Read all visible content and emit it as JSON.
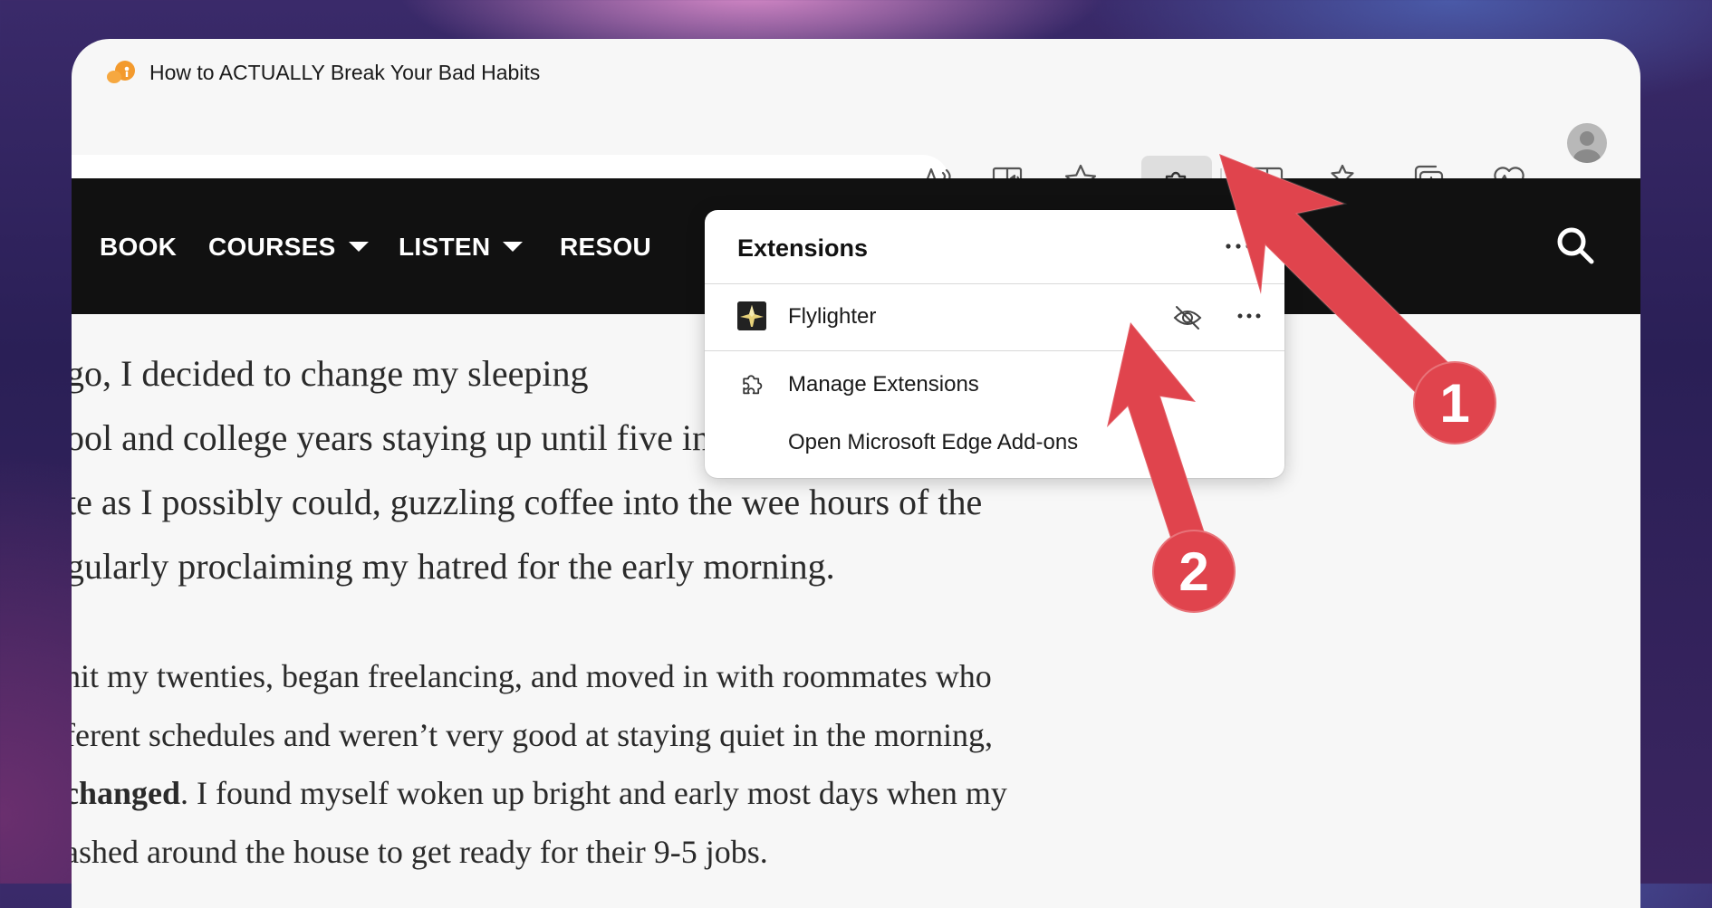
{
  "tab": {
    "title": "How to ACTUALLY Break Your Bad Habits",
    "favicon_icon": "mascot-favicon-icon"
  },
  "toolbar": {
    "icons": [
      "read-aloud-icon",
      "immersive-reader-icon",
      "favorite-star-icon",
      "extensions-puzzle-icon",
      "split-screen-icon",
      "favorites-list-icon",
      "collections-icon",
      "browser-essentials-icon",
      "profile-avatar-icon"
    ]
  },
  "nav": {
    "items": [
      "BOOK",
      "COURSES",
      "LISTEN",
      "RESOU"
    ],
    "search_icon": "search-icon"
  },
  "article": {
    "p1": [
      "go, I decided to change my sleeping",
      "ool and college years staying up until five in the morning. I’d then",
      "te as I possibly could, guzzling coffee into the wee hours of the",
      "gularly proclaiming my hatred for the early morning."
    ],
    "p2": [
      "hit my twenties, began freelancing, and moved in with roommates who",
      "ferent schedules and weren’t very good at staying quiet in the morning,"
    ],
    "p2_bold": "changed",
    "p2_line3_rest": ". I found myself woken up bright and early most days when my",
    "p2_line4": "ashed around the house to get ready for their 9-5 jobs."
  },
  "extensions_popup": {
    "title": "Extensions",
    "extensions": [
      {
        "name": "Flylighter"
      }
    ],
    "menu": [
      "Manage Extensions",
      "Open Microsoft Edge Add-ons"
    ]
  },
  "annotations": {
    "badge_1": "1",
    "badge_2": "2",
    "arrow_color": "#e0444d"
  }
}
